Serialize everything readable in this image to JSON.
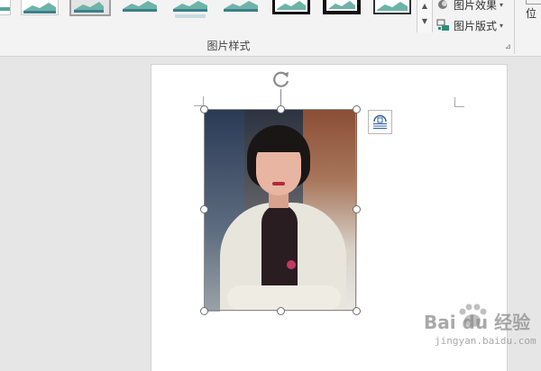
{
  "ribbon": {
    "picture_styles_group": {
      "label": "图片样式",
      "scroll_up": "▲",
      "scroll_down": "▼",
      "dialog_launcher": "⊿"
    },
    "picture_effects_button": "图片效果",
    "picture_layout_button": "图片版式",
    "dropdown_arrow": "▾",
    "position_button": "位"
  },
  "watermark": {
    "logo_text": "Bai du 经验",
    "url": "jingyan.baidu.com"
  },
  "colors": {
    "ribbon_bg": "#f3f3f3",
    "workspace_bg": "#e6e6e6",
    "page_bg": "#ffffff",
    "handle_border": "#6d6d6d",
    "accent_teal": "#2e8b7a"
  }
}
